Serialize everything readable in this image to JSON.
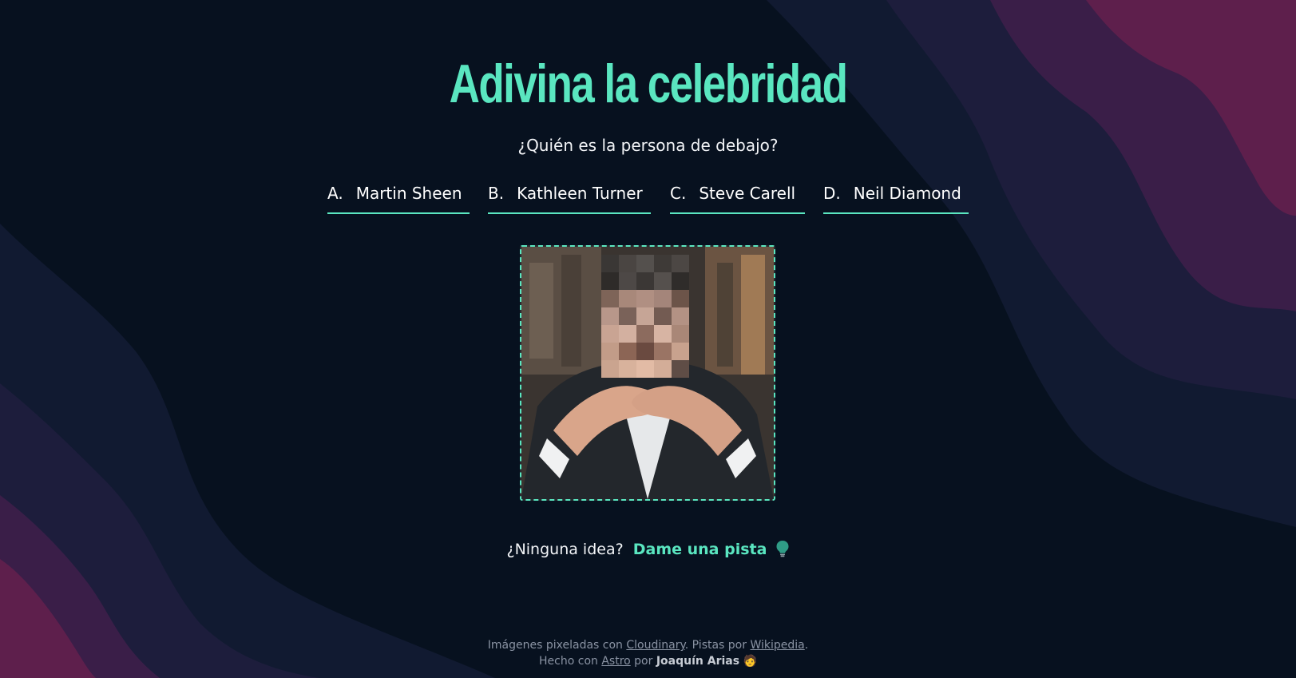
{
  "page": {
    "title": "Adivina la celebridad",
    "subtitle": "¿Quién es la persona de debajo?"
  },
  "options": [
    {
      "letter": "A.",
      "name": "Martin Sheen"
    },
    {
      "letter": "B.",
      "name": "Kathleen Turner"
    },
    {
      "letter": "C.",
      "name": "Steve Carell"
    },
    {
      "letter": "D.",
      "name": "Neil Diamond"
    }
  ],
  "hint": {
    "prompt": "¿Ninguna idea?",
    "link": "Dame una pista",
    "icon": "lightbulb-icon"
  },
  "footer": {
    "line1_prefix": "Imágenes pixeladas con",
    "line1_link1": "Cloudinary",
    "line1_mid": ". Pistas por",
    "line1_link2": "Wikipedia",
    "line1_suffix": ".",
    "line2_prefix": "Hecho con",
    "line2_link": "Astro",
    "line2_mid": "por",
    "line2_author": "Joaquín Arias",
    "line2_emoji": "🧑"
  },
  "colors": {
    "accent": "#5ae6c0",
    "background": "#07111f",
    "wave_dark": "#161c36",
    "wave_mid": "#2a1f45",
    "wave_pink": "#5b1f4a"
  }
}
